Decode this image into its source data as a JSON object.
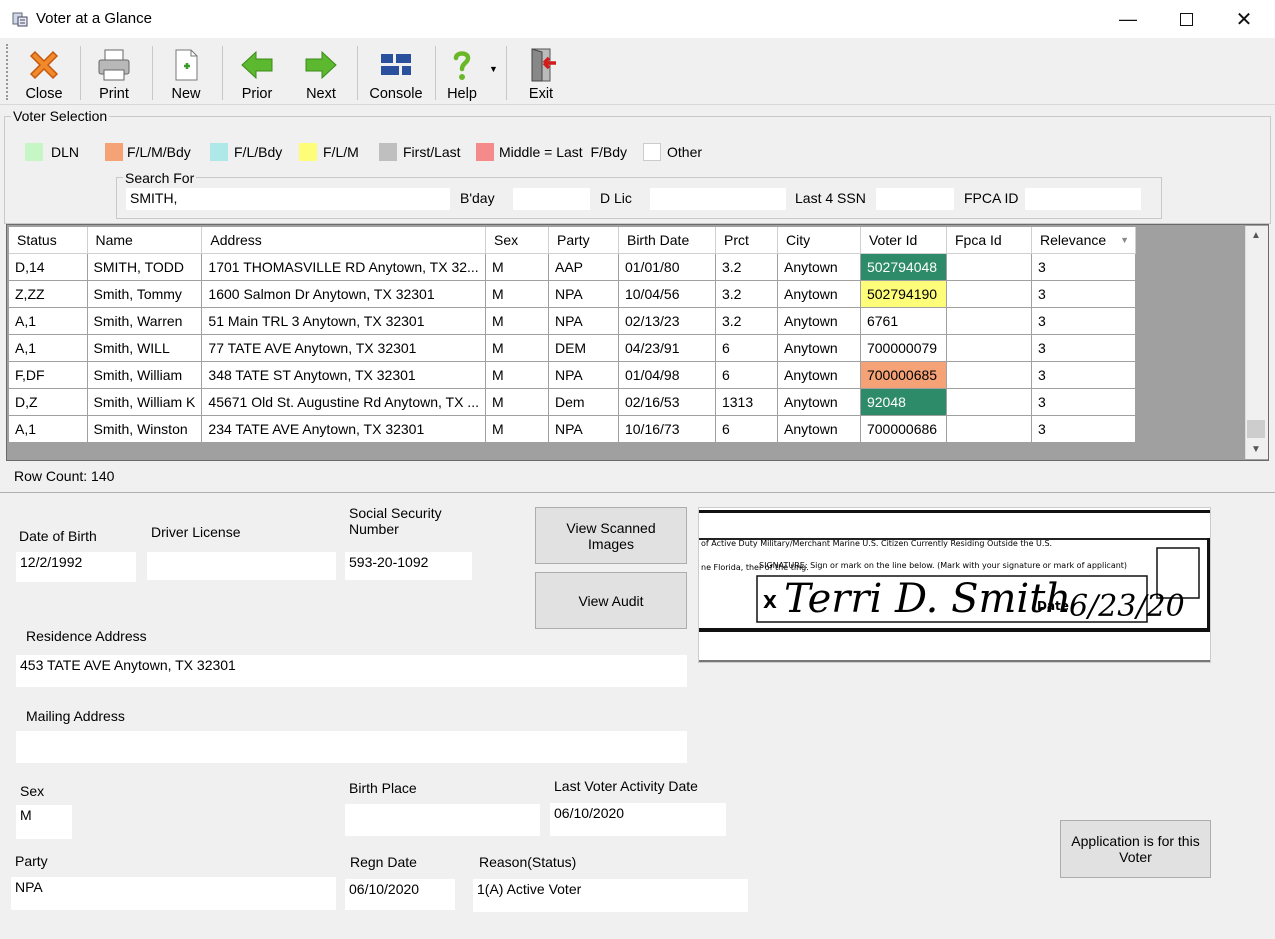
{
  "window": {
    "title": "Voter at a Glance"
  },
  "toolbar": {
    "close": "Close",
    "print": "Print",
    "new": "New",
    "prior": "Prior",
    "next": "Next",
    "console": "Console",
    "help": "Help",
    "exit": "Exit"
  },
  "selection": {
    "group_title": "Voter Selection",
    "legend": [
      {
        "label": "DLN",
        "color": "#c6f5c6"
      },
      {
        "label": "F/L/M/Bdy",
        "color": "#f4a276"
      },
      {
        "label": "F/L/Bdy",
        "color": "#aee8e8"
      },
      {
        "label": "F/L/M",
        "color": "#fdfd7a"
      },
      {
        "label": "First/Last",
        "color": "#bfbfbf"
      },
      {
        "label": "Middle = Last  F/Bdy",
        "color": "#f58a8a"
      },
      {
        "label": "Other",
        "color": "#ffffff"
      }
    ],
    "search_group_title": "Search For",
    "search_value": "SMITH,",
    "bday_label": "B'day",
    "bday_value": "",
    "dlic_label": "D Lic",
    "dlic_value": "",
    "ssn_label": "Last 4 SSN",
    "ssn_value": "",
    "fpca_label": "FPCA ID",
    "fpca_value": ""
  },
  "grid": {
    "columns": [
      "Status",
      "Name",
      "Address",
      "Sex",
      "Party",
      "Birth Date",
      "Prct",
      "City",
      "Voter Id",
      "Fpca Id",
      "Relevance"
    ],
    "rows": [
      {
        "status": "D,14",
        "name": "SMITH, TODD",
        "address": "1701 THOMASVILLE RD Anytown, TX 32...",
        "sex": "M",
        "party": "AAP",
        "birth": "01/01/80",
        "prct": "3.2",
        "city": "Anytown",
        "voter_id": "502794048",
        "fpca": "",
        "relevance": "3",
        "highlight": "#2e8b6a",
        "text_color": "#ffffff"
      },
      {
        "status": "Z,ZZ",
        "name": "Smith, Tommy",
        "address": "1600 Salmon Dr Anytown, TX 32301",
        "sex": "M",
        "party": "NPA",
        "birth": "10/04/56",
        "prct": "3.2",
        "city": "Anytown",
        "voter_id": "502794190",
        "fpca": "",
        "relevance": "3",
        "highlight": "#fdfd7a",
        "text_color": "#000000"
      },
      {
        "status": "A,1",
        "name": "Smith, Warren",
        "address": "51 Main TRL 3 Anytown, TX 32301",
        "sex": "M",
        "party": "NPA",
        "birth": "02/13/23",
        "prct": "3.2",
        "city": "Anytown",
        "voter_id": "6761",
        "fpca": "",
        "relevance": "3",
        "highlight": "",
        "text_color": "#000000"
      },
      {
        "status": "A,1",
        "name": "Smith, WILL",
        "address": "77 TATE AVE Anytown, TX 32301",
        "sex": "M",
        "party": "DEM",
        "birth": "04/23/91",
        "prct": "6",
        "city": "Anytown",
        "voter_id": "700000079",
        "fpca": "",
        "relevance": "3",
        "highlight": "",
        "text_color": "#000000"
      },
      {
        "status": "F,DF",
        "name": "Smith, William",
        "address": "348 TATE ST Anytown, TX 32301",
        "sex": "M",
        "party": "NPA",
        "birth": "01/04/98",
        "prct": "6",
        "city": "Anytown",
        "voter_id": "700000685",
        "fpca": "",
        "relevance": "3",
        "highlight": "#f4a276",
        "text_color": "#000000"
      },
      {
        "status": "D,Z",
        "name": "Smith, William K",
        "address": "45671 Old St. Augustine Rd Anytown, TX ...",
        "sex": "M",
        "party": "Dem",
        "birth": "02/16/53",
        "prct": "1313",
        "city": "Anytown",
        "voter_id": "92048",
        "fpca": "",
        "relevance": "3",
        "highlight": "#2e8b6a",
        "text_color": "#ffffff"
      },
      {
        "status": "A,1",
        "name": "Smith, Winston",
        "address": "234 TATE AVE Anytown, TX 32301",
        "sex": "M",
        "party": "NPA",
        "birth": "10/16/73",
        "prct": "6",
        "city": "Anytown",
        "voter_id": "700000686",
        "fpca": "",
        "relevance": "3",
        "highlight": "",
        "text_color": "#000000"
      }
    ],
    "row_count": "Row Count: 140"
  },
  "detail": {
    "dob_label": "Date of Birth",
    "dob_value": "12/2/1992",
    "dl_label": "Driver License",
    "dl_value": "",
    "ssn_label_1": "Social Security",
    "ssn_label_2": "Number",
    "ssn_value": "593-20-1092",
    "view_scanned": "View Scanned Images",
    "view_audit": "View Audit",
    "residence_label": "Residence Address",
    "residence_value": "453 TATE AVE Anytown, TX 32301",
    "mailing_label": "Mailing Address",
    "mailing_value": "",
    "sex_label": "Sex",
    "sex_value": "M",
    "birthplace_label": "Birth Place",
    "birthplace_value": "",
    "last_activity_label": "Last Voter Activity Date",
    "last_activity_value": "06/10/2020",
    "party_label": "Party",
    "party_value": "NPA",
    "regn_label": "Regn Date",
    "regn_value": "06/10/2020",
    "reason_label": "Reason(Status)",
    "reason_value": "1(A) Active Voter",
    "application_btn": "Application is for this Voter"
  },
  "signature": {
    "line1": "of Active Duty Military/Merchant Marine    U.S. Citizen Currently Residing Outside the U.S.",
    "line2": "SIGNATURE: Sign or mark on the line below. (Mark with your signature or mark of applicant)",
    "side": "ne Florida, ther of the ting.",
    "x_mark": "X",
    "date_label": "Date",
    "sig_text": "Terri D. Smith",
    "date_text": "6/23/20"
  }
}
